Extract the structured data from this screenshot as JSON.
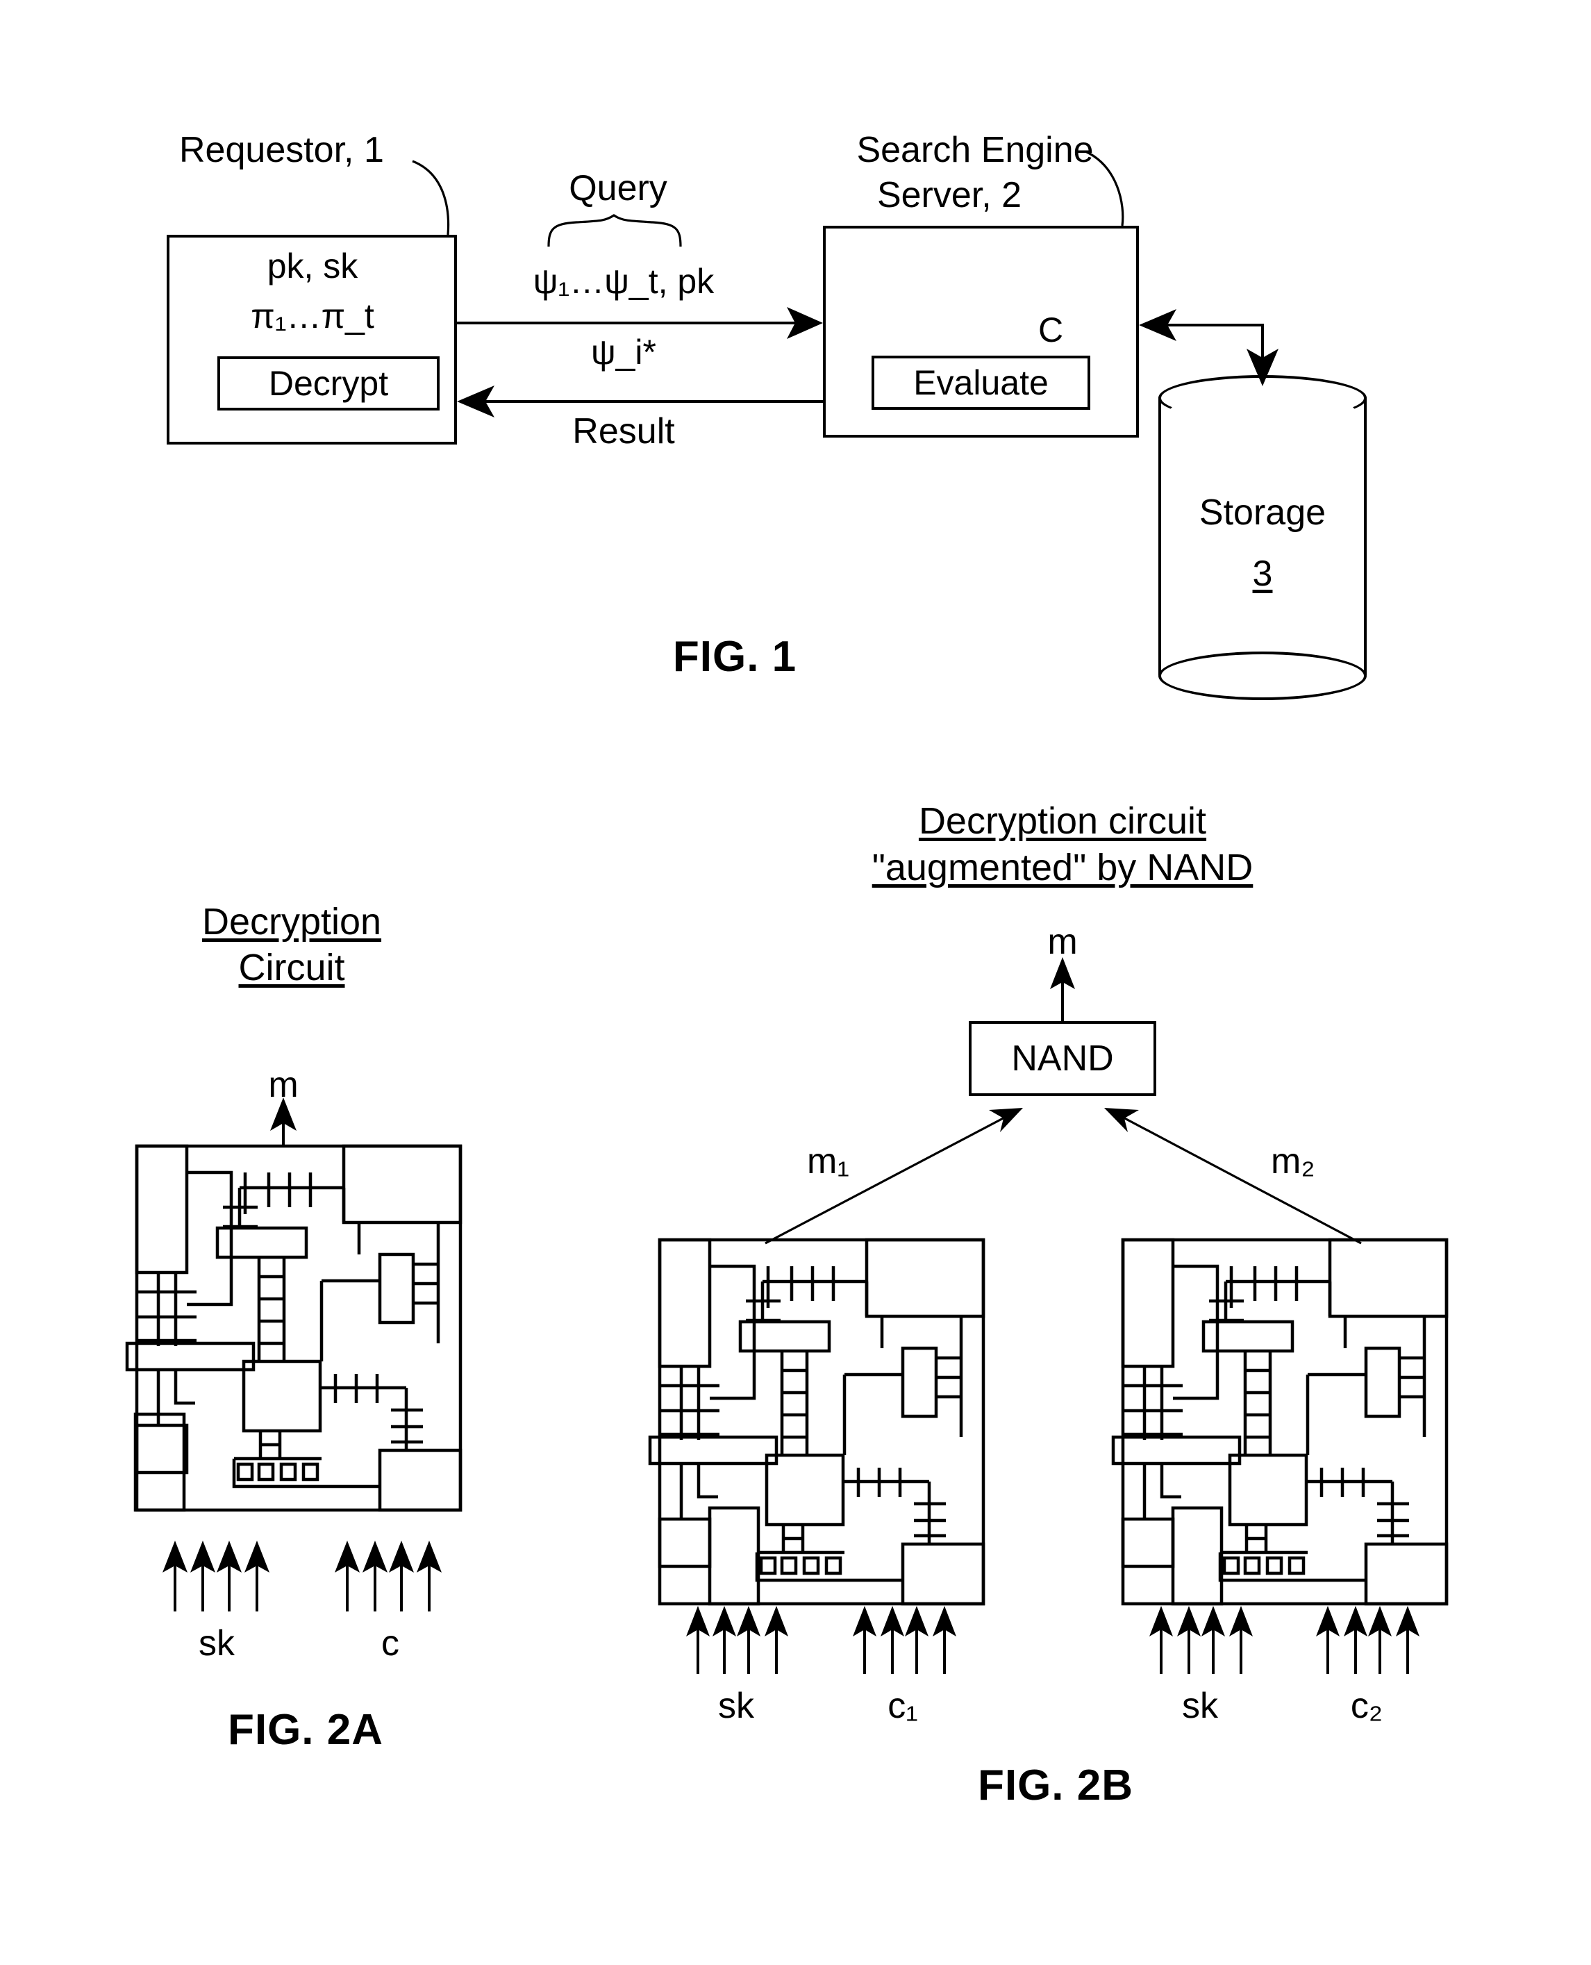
{
  "figure1": {
    "requestor_label": "Requestor, 1",
    "requestor_keys": "pk, sk",
    "requestor_params": "π₁…π_t",
    "decrypt_label": "Decrypt",
    "server_label_line1": "Search Engine",
    "server_label_line2": "Server, 2",
    "server_c": "C",
    "evaluate_label": "Evaluate",
    "query_label": "Query",
    "query_payload": "ψ₁…ψ_t, pk",
    "result_payload": "ψ_i*",
    "result_label": "Result",
    "storage_label": "Storage",
    "storage_number": "3",
    "caption": "FIG. 1"
  },
  "figure2a": {
    "title_line1": "Decryption",
    "title_line2": "Circuit",
    "output_label": "m",
    "input_label_left": "sk",
    "input_label_right": "c",
    "caption": "FIG. 2A"
  },
  "figure2b": {
    "title_line1": "Decryption circuit",
    "title_line2": "\"augmented\" by NAND",
    "output_label": "m",
    "nand_label": "NAND",
    "left_wire_label": "m₁",
    "right_wire_label": "m₂",
    "left_input_sk": "sk",
    "left_input_c": "c₁",
    "right_input_sk": "sk",
    "right_input_c": "c₂",
    "caption": "FIG. 2B"
  },
  "colors": {
    "ink": "#000000",
    "paper": "#ffffff"
  }
}
